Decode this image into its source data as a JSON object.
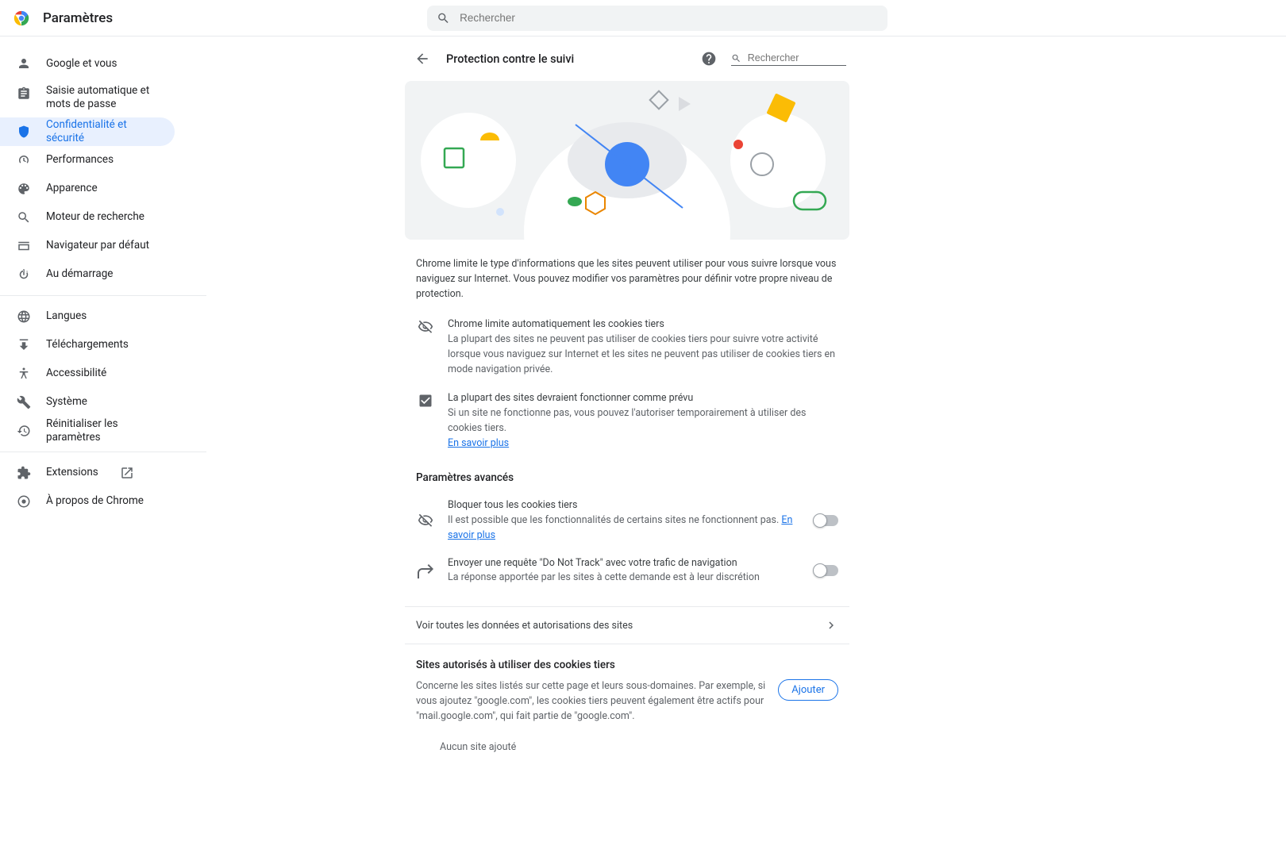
{
  "app": {
    "title": "Paramètres",
    "search_placeholder": "Rechercher"
  },
  "sidebar": {
    "items": [
      {
        "label": "Google et vous",
        "icon": "person"
      },
      {
        "label": "Saisie automatique et mots de passe",
        "icon": "assignment"
      },
      {
        "label": "Confidentialité et sécurité",
        "icon": "shield"
      },
      {
        "label": "Performances",
        "icon": "speed"
      },
      {
        "label": "Apparence",
        "icon": "palette"
      },
      {
        "label": "Moteur de recherche",
        "icon": "search"
      },
      {
        "label": "Navigateur par défaut",
        "icon": "browser"
      },
      {
        "label": "Au démarrage",
        "icon": "power"
      }
    ],
    "items2": [
      {
        "label": "Langues",
        "icon": "globe"
      },
      {
        "label": "Téléchargements",
        "icon": "download"
      },
      {
        "label": "Accessibilité",
        "icon": "accessibility"
      },
      {
        "label": "Système",
        "icon": "wrench"
      },
      {
        "label": "Réinitialiser les paramètres",
        "icon": "restore"
      }
    ],
    "items3": [
      {
        "label": "Extensions",
        "icon": "extension",
        "external": true
      },
      {
        "label": "À propos de Chrome",
        "icon": "chrome"
      }
    ]
  },
  "panel": {
    "title": "Protection contre le suivi",
    "search_placeholder": "Rechercher",
    "intro": "Chrome limite le type d'informations que les sites peuvent utiliser pour vous suivre lorsque vous naviguez sur Internet. Vous pouvez modifier vos paramètres pour définir votre propre niveau de protection.",
    "info1": {
      "title": "Chrome limite automatiquement les cookies tiers",
      "desc": "La plupart des sites ne peuvent pas utiliser de cookies tiers pour suivre votre activité lorsque vous naviguez sur Internet et les sites ne peuvent pas utiliser de cookies tiers en mode navigation privée."
    },
    "info2": {
      "title": "La plupart des sites devraient fonctionner comme prévu",
      "desc": "Si un site ne fonctionne pas, vous pouvez l'autoriser temporairement à utiliser des cookies tiers.",
      "link": "En savoir plus"
    },
    "advanced_title": "Paramètres avancés",
    "toggle1": {
      "title": "Bloquer tous les cookies tiers",
      "desc": "Il est possible que les fonctionnalités de certains sites ne fonctionnent pas. ",
      "link": "En savoir plus"
    },
    "toggle2": {
      "title": "Envoyer une requête \"Do Not Track\" avec votre trafic de navigation",
      "desc": "La réponse apportée par les sites à cette demande est à leur discrétion"
    },
    "nav_row": "Voir toutes les données et autorisations des sites",
    "allowed": {
      "title": "Sites autorisés à utiliser des cookies tiers",
      "desc": "Concerne les sites listés sur cette page et leurs sous-domaines. Par exemple, si vous ajoutez \"google.com\", les cookies tiers peuvent également être actifs pour \"mail.google.com\", qui fait partie de \"google.com\".",
      "add_button": "Ajouter",
      "empty": "Aucun site ajouté"
    }
  }
}
